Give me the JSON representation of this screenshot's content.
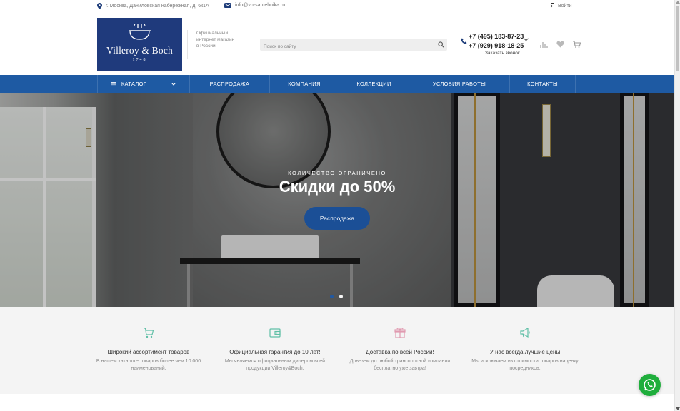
{
  "topbar": {
    "address": "г. Москва, Даниловская набережная, д. 6к1А",
    "email": "info@vb-santehnika.ru",
    "login": "Войти"
  },
  "header": {
    "logo_brand": "Villeroy & Boch",
    "logo_year": "1748",
    "tagline_1": "Официальный",
    "tagline_2": "интернет магазин",
    "tagline_3": "в России",
    "search_placeholder": "Поиск по сайту",
    "phone_1": "+7 (495) 183-87-23",
    "phone_2": "+7 (929) 918-18-25",
    "callback": "Заказать звонок"
  },
  "nav": {
    "items": [
      "КАТАЛОГ",
      "РАСПРОДАЖА",
      "КОМПАНИЯ",
      "КОЛЛЕКЦИИ",
      "УСЛОВИЯ РАБОТЫ",
      "КОНТАКТЫ"
    ]
  },
  "hero": {
    "kicker": "КОЛИЧЕСТВО ОГРАНИЧЕНО",
    "title": "Скидки до 50%",
    "cta": "Распродажа"
  },
  "features": [
    {
      "title": "Широкий ассортимент товаров",
      "text": "В нашем каталоге товаров более чем 10 000 наименований.",
      "icon": "cart-icon"
    },
    {
      "title": "Официальная гарантия до 10 лет!",
      "text": "Мы являемся официальным дилером всей продукции Villeroy&Boch.",
      "icon": "wallet-icon"
    },
    {
      "title": "Доставка по всей России!",
      "text": "Довезем до любой транспортной компании бесплатно уже завтра!",
      "icon": "gift-icon"
    },
    {
      "title": "У нас всегда лучшие цены",
      "text": "Мы исключаем из стоимости товаров наценку посредников.",
      "icon": "megaphone-icon"
    }
  ],
  "colors": {
    "brand_blue": "#1f3a7c",
    "nav_blue": "#1e5aa3",
    "cta_blue": "#1b4f96",
    "feature_icon": "#5fbfa6",
    "whatsapp_green": "#1fae3c"
  }
}
